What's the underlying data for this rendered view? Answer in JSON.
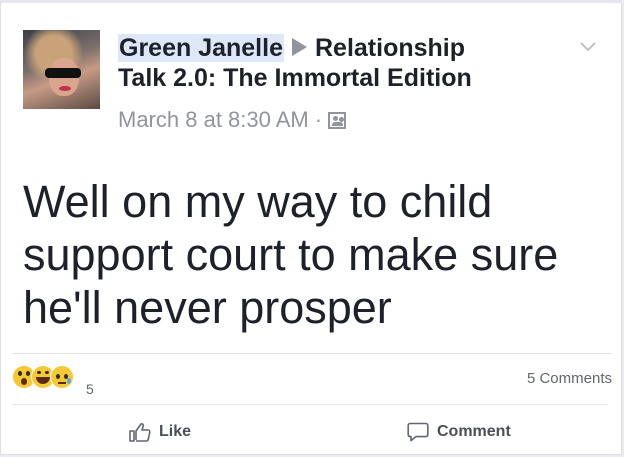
{
  "post": {
    "author": "Green Janelle",
    "group": "Relationship Talk 2.0: The Immortal Edition",
    "group_line1": "Relationship",
    "group_line2": "Talk 2.0: The Immortal Edition",
    "timestamp": "March 8 at 8:30 AM",
    "separator": "·",
    "audience_icon": "group-icon",
    "body_lines": [
      "Well on my way to child",
      "support court to make sure",
      "he'll never prosper"
    ]
  },
  "reactions": {
    "types": [
      "wow",
      "haha",
      "sad"
    ],
    "count": "5"
  },
  "comments": {
    "count_label": "5 Comments"
  },
  "actions": {
    "like_label": "Like",
    "comment_label": "Comment"
  },
  "colors": {
    "text": "#1d2129",
    "meta": "#90949c",
    "highlight": "#dde7f7",
    "action_text": "#4b4f56"
  }
}
